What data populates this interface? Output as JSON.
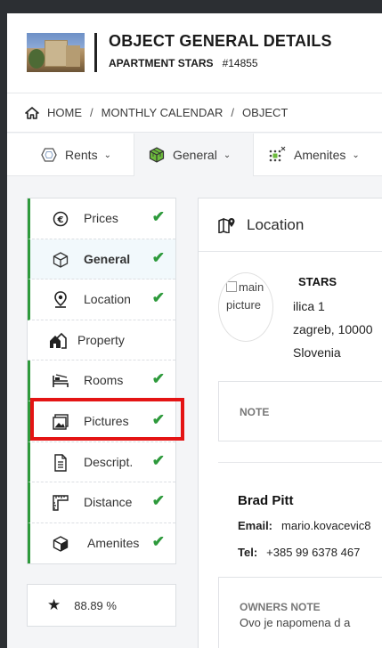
{
  "header": {
    "title": "OBJECT GENERAL DETAILS",
    "object_name": "APARTMENT STARS",
    "object_id": "#14855"
  },
  "breadcrumb": {
    "items": [
      "HOME",
      "MONTHLY CALENDAR",
      "OBJECT"
    ],
    "separator": "/"
  },
  "tabs": [
    {
      "label": "Rents",
      "icon": "hexagon-icon"
    },
    {
      "label": "General",
      "icon": "cube-icon",
      "active": true
    },
    {
      "label": "Amenites",
      "icon": "grid-dots-icon"
    }
  ],
  "sidenav": {
    "items": [
      {
        "label": "Prices",
        "icon": "euro-icon",
        "done": true
      },
      {
        "label": "General",
        "icon": "cube-icon",
        "done": true,
        "current": true
      },
      {
        "label": "Location",
        "icon": "map-pin-icon",
        "done": true
      },
      {
        "label": "Property",
        "icon": "houses-icon",
        "done": false
      },
      {
        "label": "Rooms",
        "icon": "bed-icon",
        "done": true
      },
      {
        "label": "Pictures",
        "icon": "image-icon",
        "done": true
      },
      {
        "label": "Descript.",
        "icon": "document-icon",
        "done": true
      },
      {
        "label": "Distance",
        "icon": "ruler-icon",
        "done": true
      },
      {
        "label": "Amenites",
        "icon": "box-icon",
        "done": true
      }
    ],
    "check_glyph": "✔"
  },
  "score": {
    "value": "88.89 %"
  },
  "panel": {
    "title": "Location",
    "picture_alt": "main picture",
    "property_name": "STARS",
    "address": "ilica 1",
    "city": "zagreb, 10000",
    "country": "Slovenia",
    "note_label": "NOTE",
    "owner": {
      "name": "Brad Pitt",
      "email_label": "Email:",
      "email": "mario.kovacevic8",
      "tel_label": "Tel:",
      "tel": "+385 99 6378 467"
    },
    "owners_note_label": "OWNERS NOTE",
    "owners_note": "Ovo je napomena d a"
  },
  "colors": {
    "accent_green": "#2e9a3c",
    "highlight_red": "#e41414"
  }
}
